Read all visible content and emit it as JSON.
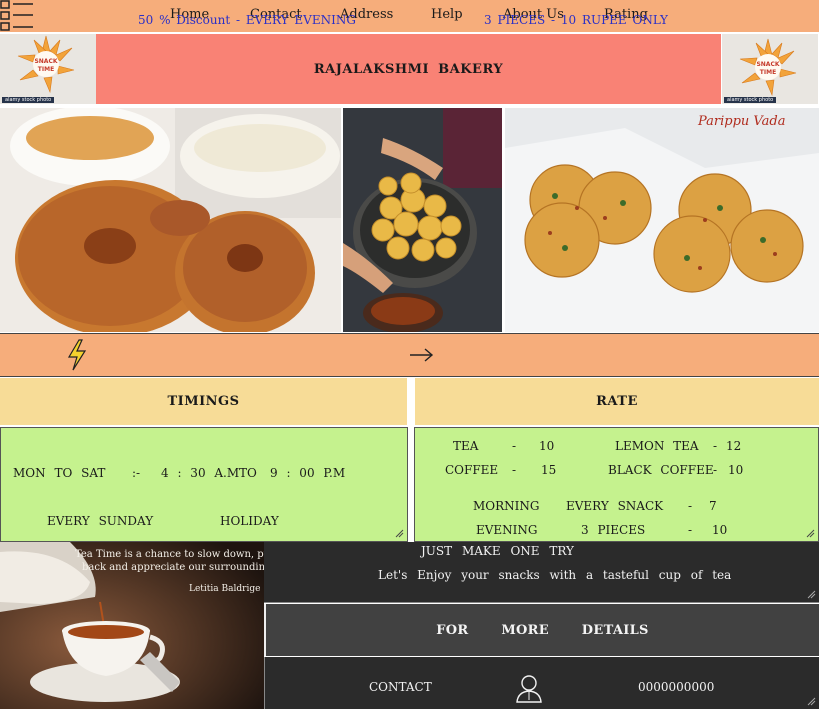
{
  "nav": {
    "items": [
      "Home",
      "Contact",
      "Address",
      "Help",
      "About Us",
      "Rating"
    ]
  },
  "header": {
    "title": "RAJALAKSHMI  BAKERY",
    "logo_text": "SNACK TIME",
    "logo_credit": "alamy stock photo"
  },
  "photos": {
    "photo3_caption": "Parippu Vada"
  },
  "offer": {
    "discount_text": "50 %  Discount  -    EVERY  EVENING",
    "pieces_text": "3   PIECES -   10  RUPEE  ONLY"
  },
  "timings": {
    "heading": "TIMINGS",
    "days": "MON   TO   SAT",
    "sep": ":-",
    "from_time": "4 : 30  A.M",
    "to_label": "TO",
    "to_time": "9  : 00 P.M",
    "sunday": "EVERY   SUNDAY",
    "holiday": "HOLIDAY"
  },
  "rate": {
    "heading": "RATE",
    "rows": [
      {
        "item": "TEA",
        "dash": "-",
        "price": "10"
      },
      {
        "item": "COFFEE",
        "dash": "-",
        "price": "15"
      },
      {
        "item": "LEMON   TEA",
        "dash": "-",
        "price": "12"
      },
      {
        "item": "BLACK  COFFEE",
        "dash": "-",
        "price": "10"
      },
      {
        "item": "MORNING",
        "item2": "EVERY   SNACK",
        "dash": "-",
        "price": "7"
      },
      {
        "item": "EVENING",
        "item2": "3   PIECES",
        "dash": "-",
        "price": "10"
      }
    ]
  },
  "tea_image": {
    "quote_line1": "Tea Time is a chance to slow down, pull",
    "quote_line2": "back and appreciate our surroundings",
    "author": "Letitia Baldrige"
  },
  "try": {
    "heading": "JUST   MAKE   ONE   TRY",
    "tagline": "Let's   Enjoy  your  snacks  with  a  tasteful  cup  of  tea"
  },
  "details": {
    "text": "FOR MORE DETAILS"
  },
  "contact": {
    "label": "CONTACT",
    "phone": "0000000000",
    "icon": "person-icon"
  },
  "colors": {
    "nav_bg": "#f6ad7b",
    "title_bg": "#f98275",
    "section_head_bg": "#f7dc97",
    "green_bg": "#c5f28e",
    "offer_text": "#2a2fc7",
    "dark_panel": "#2b2b2b"
  }
}
